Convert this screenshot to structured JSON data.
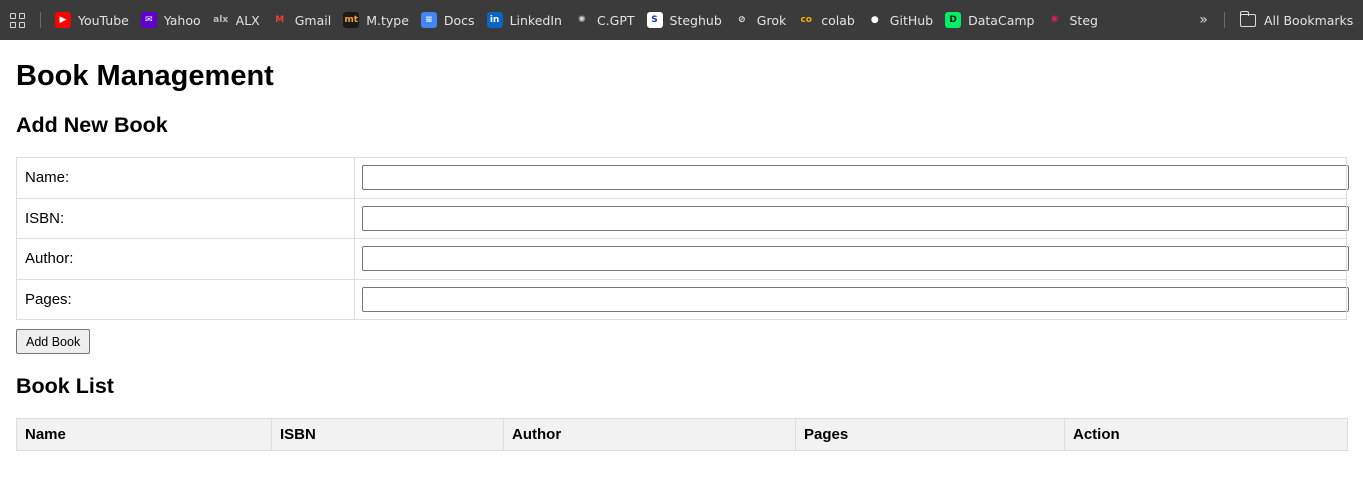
{
  "bookmarks": {
    "items": [
      {
        "label": "YouTube",
        "icon": "youtube-icon",
        "glyph": "▶",
        "bg": "#ff0000",
        "fg": "#ffffff"
      },
      {
        "label": "Yahoo",
        "icon": "yahoo-icon",
        "glyph": "✉",
        "bg": "#6001d2",
        "fg": "#ffffff"
      },
      {
        "label": "ALX",
        "icon": "alx-icon",
        "glyph": "alx",
        "bg": "transparent",
        "fg": "#bdbdbd"
      },
      {
        "label": "Gmail",
        "icon": "gmail-icon",
        "glyph": "M",
        "bg": "transparent",
        "fg": "#ea4335"
      },
      {
        "label": "M.type",
        "icon": "mtype-icon",
        "glyph": "mt",
        "bg": "#1a1a1a",
        "fg": "#f5a623"
      },
      {
        "label": "Docs",
        "icon": "docs-icon",
        "glyph": "≡",
        "bg": "#4285f4",
        "fg": "#ffffff"
      },
      {
        "label": "LinkedIn",
        "icon": "linkedin-icon",
        "glyph": "in",
        "bg": "#0a66c2",
        "fg": "#ffffff"
      },
      {
        "label": "C.GPT",
        "icon": "chatgpt-icon",
        "glyph": "✺",
        "bg": "transparent",
        "fg": "#d6d6d6"
      },
      {
        "label": "Steghub",
        "icon": "steghub-icon",
        "glyph": "S",
        "bg": "#ffffff",
        "fg": "#1c3aa9"
      },
      {
        "label": "Grok",
        "icon": "grok-icon",
        "glyph": "⊘",
        "bg": "transparent",
        "fg": "#e3e3e3"
      },
      {
        "label": "colab",
        "icon": "colab-icon",
        "glyph": "co",
        "bg": "transparent",
        "fg": "#f9ab00"
      },
      {
        "label": "GitHub",
        "icon": "github-icon",
        "glyph": "●",
        "bg": "transparent",
        "fg": "#ffffff"
      },
      {
        "label": "DataCamp",
        "icon": "datacamp-icon",
        "glyph": "Ⅾ",
        "bg": "#03ef62",
        "fg": "#05192d"
      },
      {
        "label": "Steg",
        "icon": "slack-icon",
        "glyph": "✱",
        "bg": "transparent",
        "fg": "#e01e5a"
      }
    ],
    "overflow_glyph": "»",
    "all_bookmarks_label": "All Bookmarks"
  },
  "page": {
    "title": "Book Management",
    "add_section_title": "Add New Book",
    "form": {
      "fields": [
        {
          "label": "Name:",
          "value": "",
          "placeholder": ""
        },
        {
          "label": "ISBN:",
          "value": "",
          "placeholder": ""
        },
        {
          "label": "Author:",
          "value": "",
          "placeholder": ""
        },
        {
          "label": "Pages:",
          "value": "",
          "placeholder": ""
        }
      ],
      "submit_label": "Add Book"
    },
    "list_section_title": "Book List",
    "list_table": {
      "columns": [
        "Name",
        "ISBN",
        "Author",
        "Pages",
        "Action"
      ],
      "rows": []
    }
  }
}
